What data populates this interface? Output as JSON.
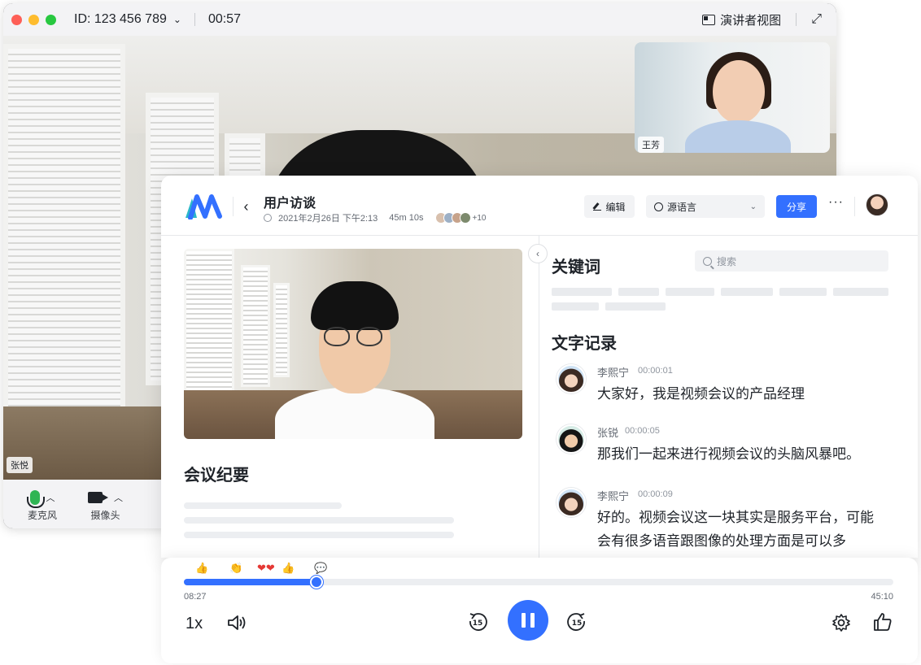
{
  "meeting": {
    "id_label": "ID: 123 456 789",
    "timer": "00:57",
    "speaker_view_label": "演讲者视图",
    "main_participant": "张悦",
    "pip_participant": "王芳",
    "controls": {
      "mic_label": "麦克风",
      "camera_label": "摄像头"
    }
  },
  "record": {
    "title": "用户访谈",
    "date": "2021年2月26日 下午2:13",
    "duration": "45m 10s",
    "more_participants": "+10",
    "edit_label": "编辑",
    "language_label": "源语言",
    "share_label": "分享",
    "more_label": "···"
  },
  "left": {
    "summary_title": "会议纪要"
  },
  "right": {
    "keywords_title": "关键词",
    "search_placeholder": "搜索",
    "transcript_title": "文字记录",
    "transcript": [
      {
        "speaker": "李熙宁",
        "time": "00:00:01",
        "text": "大家好，我是视频会议的产品经理"
      },
      {
        "speaker": "张锐",
        "time": "00:00:05",
        "text": "那我们一起来进行视频会议的头脑风暴吧。"
      },
      {
        "speaker": "李熙宁",
        "time": "00:00:09",
        "text": "好的。视频会议这一块其实是服务平台，可能会有很多语音跟图像的处理方面是可以多"
      }
    ]
  },
  "player": {
    "current_time": "08:27",
    "total_time": "45:10",
    "progress": 0.187,
    "speed": "1x",
    "reactions": [
      "👍",
      "👏",
      "❤❤",
      "👍",
      "💬"
    ],
    "accent": "#3370ff"
  }
}
